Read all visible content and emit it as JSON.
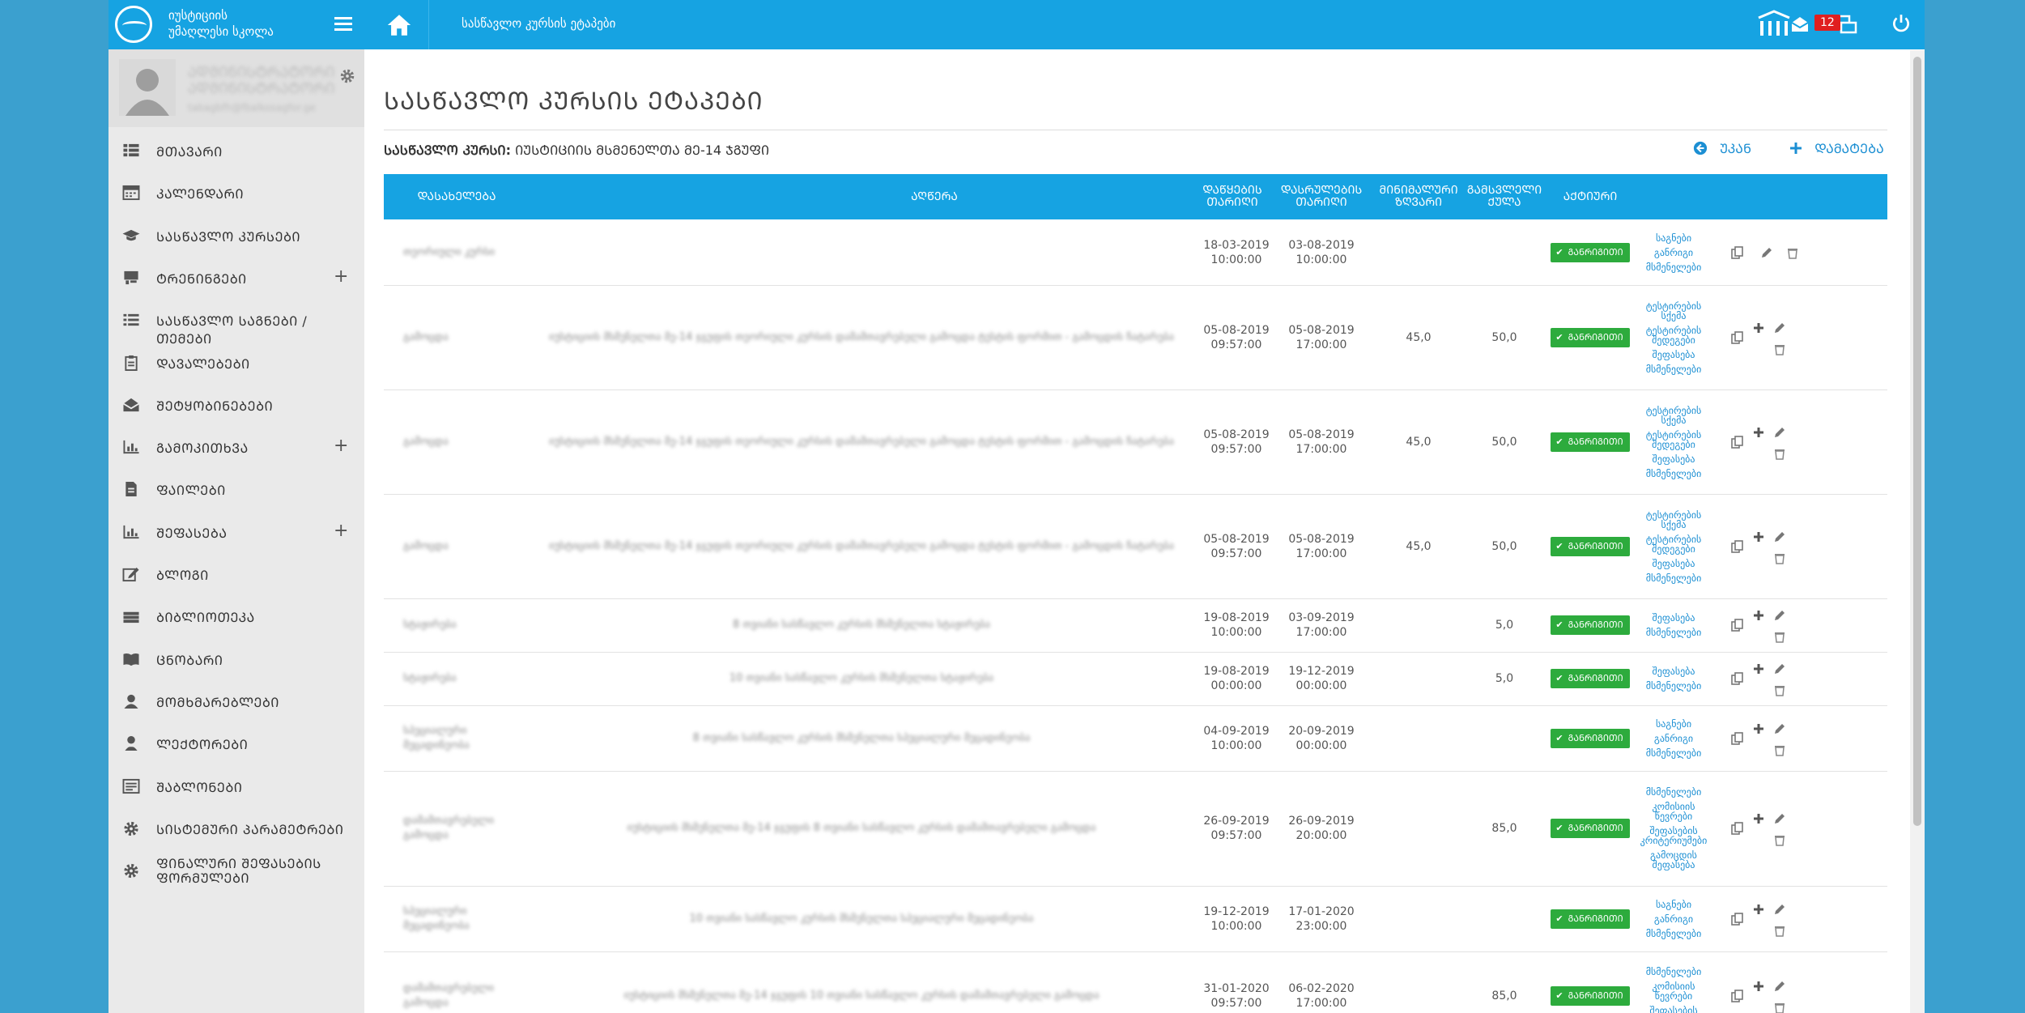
{
  "logo": {
    "line1": "იუსტიციის",
    "line2": "უმაღლესი სკოლა"
  },
  "breadcrumb": "სასწავლო კურსის ეტაპები",
  "topbar": {
    "mail_count": "12"
  },
  "user": {
    "name1": "ᲐᲓᲛᲘᲜᲘᲡᲢᲠᲐᲢᲝᲠᲘ",
    "name2": "ᲐᲓᲛᲘᲜᲘᲡᲢᲠᲐᲢᲝᲠᲘ",
    "email": "tabagbfh@fbalkosagfor.ge"
  },
  "sidebar": {
    "items": [
      {
        "label": "ᲛᲗᲐᲕᲐᲠᲘ",
        "icon": "dashboard-icon",
        "plus": false
      },
      {
        "label": "ᲙᲐᲚᲔᲜᲓᲐᲠᲘ",
        "icon": "calendar-icon",
        "plus": false
      },
      {
        "label": "ᲡᲐᲡᲬᲐᲕᲚᲝ ᲙᲣᲠᲡᲔᲑᲘ",
        "icon": "graduation-cap-icon",
        "plus": false
      },
      {
        "label": "ᲢᲠᲔᲜᲘᲜᲒᲔᲑᲘ",
        "icon": "training-icon",
        "plus": true
      },
      {
        "label": "ᲡᲐᲡᲬᲐᲕᲚᲝ ᲡᲐᲒᲜᲔᲑᲘ / ᲗᲔᲛᲔᲑᲘ",
        "icon": "list-icon",
        "plus": false
      },
      {
        "label": "ᲓᲐᲕᲐᲚᲔᲑᲔᲑᲘ",
        "icon": "clipboard-icon",
        "plus": false
      },
      {
        "label": "ᲨᲔᲢᲧᲝᲑᲘᲜᲔᲑᲔᲑᲘ",
        "icon": "envelope-open-icon",
        "plus": false
      },
      {
        "label": "ᲒᲐᲛᲝᲙᲘᲗᲮᲕᲐ",
        "icon": "bar-chart-icon",
        "plus": true
      },
      {
        "label": "ᲤᲐᲘᲚᲔᲑᲘ",
        "icon": "file-icon",
        "plus": false
      },
      {
        "label": "ᲨᲔᲤᲐᲡᲔᲑᲐ",
        "icon": "bar-chart-icon",
        "plus": true
      },
      {
        "label": "ᲑᲚᲝᲒᲘ",
        "icon": "edit-icon",
        "plus": false
      },
      {
        "label": "ᲑᲘᲑᲚᲘᲝᲗᲔᲙᲐ",
        "icon": "library-icon",
        "plus": false
      },
      {
        "label": "ᲪᲜᲝᲑᲐᲠᲘ",
        "icon": "book-icon",
        "plus": false
      },
      {
        "label": "ᲛᲝᲛᲮᲛᲐᲠᲔᲑᲚᲔᲑᲘ",
        "icon": "user-icon",
        "plus": false
      },
      {
        "label": "ᲚᲔᲥᲢᲝᲠᲔᲑᲘ",
        "icon": "lecturer-icon",
        "plus": false
      },
      {
        "label": "ᲨᲐᲑᲚᲝᲜᲔᲑᲘ",
        "icon": "template-icon",
        "plus": false
      },
      {
        "label": "ᲡᲘᲡᲢᲔᲛᲣᲠᲘ ᲞᲐᲠᲐᲛᲔᲢᲠᲔᲑᲘ",
        "icon": "cog-icon",
        "plus": false
      },
      {
        "label": "ᲤᲘᲜᲐᲚᲣᲠᲘ ᲨᲔᲤᲐᲡᲔᲑᲘᲡ ᲤᲝᲠᲛᲣᲚᲔᲑᲘ",
        "icon": "cog-icon",
        "plus": false
      }
    ]
  },
  "page": {
    "title": "ᲡᲐᲡᲬᲐᲕᲚᲝ ᲙᲣᲠᲡᲘᲡ ᲔᲢᲐᲞᲔᲑᲘ",
    "course_label": "ᲡᲐᲡᲬᲐᲕᲚᲝ ᲙᲣᲠᲡᲘ:",
    "course_value": "ᲘᲣᲡᲢᲘᲪᲘᲘᲡ ᲛᲡᲛᲔᲜᲔᲚᲗᲐ ᲛᲔ-14 ᲯᲒᲣᲤᲘ",
    "back_label": "ᲣᲙᲐᲜ",
    "add_label": "ᲓᲐᲛᲐᲢᲔᲑᲐ"
  },
  "table": {
    "headers": {
      "name": "ᲓᲐᲡᲐᲮᲔᲚᲔᲑᲐ",
      "desc": "ᲐᲦᲬᲔᲠᲐ",
      "start": "ᲓᲐᲬᲧᲔᲑᲘᲡ ᲗᲐᲠᲘᲦᲘ",
      "end": "ᲓᲐᲡᲠᲣᲚᲔᲑᲘᲡ ᲗᲐᲠᲘᲦᲘ",
      "min": "ᲛᲘᲜᲘᲛᲐᲚᲣᲠᲘ ᲖᲦᲕᲐᲠᲘ",
      "max": "ᲒᲐᲛᲡᲕᲚᲔᲚᲘ ᲥᲣᲚᲐ",
      "active": "ᲐᲥᲢᲘᲣᲠᲘ"
    },
    "status_label": "ᲒᲐᲜᲠᲘᲒᲘᲗᲘ",
    "rows": [
      {
        "name": "თეორიული კურსი",
        "desc": "",
        "start": [
          "18-03-2019",
          "10:00:00"
        ],
        "end": [
          "03-08-2019",
          "10:00:00"
        ],
        "min": "",
        "max": "",
        "links": [
          "საგნები",
          "განრიგი",
          "მსმენელები"
        ],
        "copy": true,
        "plus": false,
        "edit": true,
        "del": true
      },
      {
        "name": "გამოცდა",
        "desc": "იუსტიციის მსმენელთა მე-14 ჯგუფის თეორიული კურსის დამამთავრებელი გამოცდა ტესტის ფორმით - გამოცდის ჩატარება",
        "start": [
          "05-08-2019",
          "09:57:00"
        ],
        "end": [
          "05-08-2019",
          "17:00:00"
        ],
        "min": "45,0",
        "max": "50,0",
        "links": [
          "ტესტირების სქემა",
          "ტესტირების შედეგები",
          "შეფასება",
          "მსმენელები"
        ],
        "copy": true,
        "plus": true,
        "edit": true,
        "del": true
      },
      {
        "name": "გამოცდა",
        "desc": "იუსტიციის მსმენელთა მე-14 ჯგუფის თეორიული კურსის დამამთავრებელი გამოცდა ტესტის ფორმით - გამოცდის ჩატარება",
        "start": [
          "05-08-2019",
          "09:57:00"
        ],
        "end": [
          "05-08-2019",
          "17:00:00"
        ],
        "min": "45,0",
        "max": "50,0",
        "links": [
          "ტესტირების სქემა",
          "ტესტირების შედეგები",
          "შეფასება",
          "მსმენელები"
        ],
        "copy": true,
        "plus": true,
        "edit": true,
        "del": true
      },
      {
        "name": "გამოცდა",
        "desc": "იუსტიციის მსმენელთა მე-14 ჯგუფის თეორიული კურსის დამამთავრებელი გამოცდა ტესტის ფორმით - გამოცდის ჩატარება",
        "start": [
          "05-08-2019",
          "09:57:00"
        ],
        "end": [
          "05-08-2019",
          "17:00:00"
        ],
        "min": "45,0",
        "max": "50,0",
        "links": [
          "ტესტირების სქემა",
          "ტესტირების შედეგები",
          "შეფასება",
          "მსმენელები"
        ],
        "copy": true,
        "plus": true,
        "edit": true,
        "del": true
      },
      {
        "name": "სტაჟირება",
        "desc": "8 თვიანი სასწავლო კურსის მსმენელთა სტაჟირება",
        "start": [
          "19-08-2019",
          "10:00:00"
        ],
        "end": [
          "03-09-2019",
          "17:00:00"
        ],
        "min": "",
        "max": "5,0",
        "links": [
          "შეფასება",
          "მსმენელები"
        ],
        "copy": true,
        "plus": true,
        "edit": true,
        "del": true
      },
      {
        "name": "სტაჟირება",
        "desc": "10 თვიანი სასწავლო კურსის მსმენელთა სტაჟირება",
        "start": [
          "19-08-2019",
          "00:00:00"
        ],
        "end": [
          "19-12-2019",
          "00:00:00"
        ],
        "min": "",
        "max": "5,0",
        "links": [
          "შეფასება",
          "მსმენელები"
        ],
        "copy": true,
        "plus": true,
        "edit": true,
        "del": true
      },
      {
        "name": "სპეციალური მეცადინეობა",
        "desc": "8 თვიანი სასწავლო კურსის მსმენელთა სპეციალური მეცადინეობა",
        "start": [
          "04-09-2019",
          "10:00:00"
        ],
        "end": [
          "20-09-2019",
          "00:00:00"
        ],
        "min": "",
        "max": "",
        "links": [
          "საგნები",
          "განრიგი",
          "მსმენელები"
        ],
        "copy": true,
        "plus": true,
        "edit": true,
        "del": true
      },
      {
        "name": "დამამთავრებელი გამოცდა",
        "desc": "იუსტიციის მსმენელთა მე-14 ჯგუფის 8 თვიანი სასწავლო კურსის დამამთავრებელი გამოცდა",
        "start": [
          "26-09-2019",
          "09:57:00"
        ],
        "end": [
          "26-09-2019",
          "20:00:00"
        ],
        "min": "",
        "max": "85,0",
        "links": [
          "მსმენელები",
          "კომისიის წევრები",
          "შეფასების კრიტერიუმები",
          "გამოცდის შეფასება"
        ],
        "copy": true,
        "plus": true,
        "edit": true,
        "del": true
      },
      {
        "name": "სპეციალური მეცადინეობა",
        "desc": "10 თვიანი სასწავლო კურსის მსმენელთა სპეციალური მეცადინეობა",
        "start": [
          "19-12-2019",
          "10:00:00"
        ],
        "end": [
          "17-01-2020",
          "23:00:00"
        ],
        "min": "",
        "max": "",
        "links": [
          "საგნები",
          "განრიგი",
          "მსმენელები"
        ],
        "copy": true,
        "plus": true,
        "edit": true,
        "del": true
      },
      {
        "name": "დამამთავრებელი გამოცდა",
        "desc": "იუსტიციის მსმენელთა მე-14 ჯგუფის 10 თვიანი სასწავლო კურსის დამამთავრებელი გამოცდა",
        "start": [
          "31-01-2020",
          "09:57:00"
        ],
        "end": [
          "06-02-2020",
          "17:00:00"
        ],
        "min": "",
        "max": "85,0",
        "links": [
          "მსმენელები",
          "კომისიის წევრები",
          "შეფასების კრიტერიუმები"
        ],
        "copy": true,
        "plus": true,
        "edit": true,
        "del": true
      }
    ]
  }
}
